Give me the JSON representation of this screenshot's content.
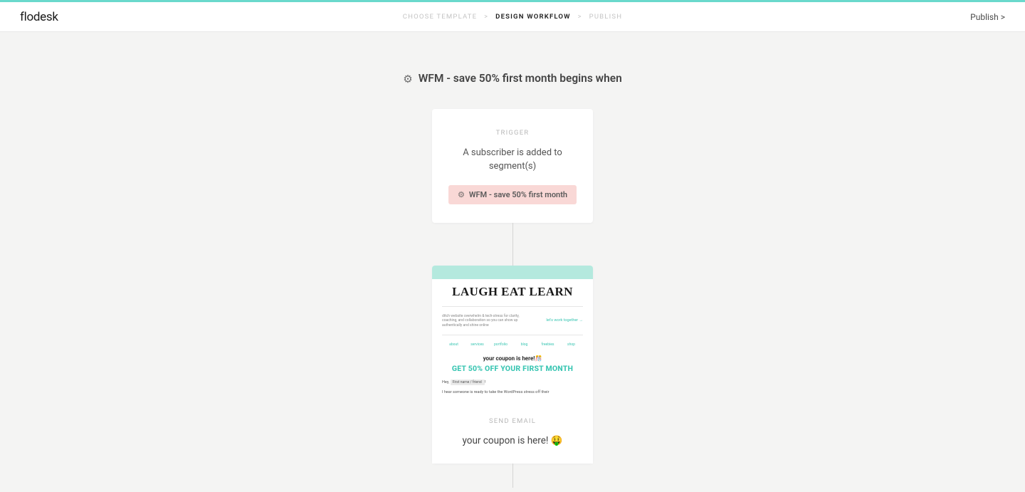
{
  "header": {
    "logo": "flodesk",
    "breadcrumb": {
      "step1": "CHOOSE TEMPLATE",
      "step2": "DESIGN WORKFLOW",
      "step3": "PUBLISH"
    },
    "publish_button": "Publish >"
  },
  "workflow": {
    "title": "WFM - save 50% first month begins when",
    "trigger": {
      "label": "TRIGGER",
      "description": "A subscriber is added to segment(s)",
      "segment_tag": "WFM - save 50% first month"
    },
    "email_step": {
      "label": "SEND EMAIL",
      "subject": "your coupon is here! 🤑",
      "preview": {
        "brand": "LAUGH EAT LEARN",
        "tagline": "ditch website overwhelm & tech-stress for clarity, coaching, and collaboration so you can show up authentically and shine online",
        "cta_small": "let's work together →",
        "nav": {
          "n1": "about",
          "n2": "services",
          "n3": "portfolio",
          "n4": "blog",
          "n5": "freebies",
          "n6": "shop"
        },
        "headline": "your coupon is here!🎊",
        "subhead": "GET 50% OFF YOUR FIRST MONTH",
        "greeting_prefix": "Hey,",
        "greeting_field": "First name / friend",
        "greeting_suffix": "!",
        "body_line": "I hear someone is ready to take the WordPress stress off their"
      }
    }
  }
}
